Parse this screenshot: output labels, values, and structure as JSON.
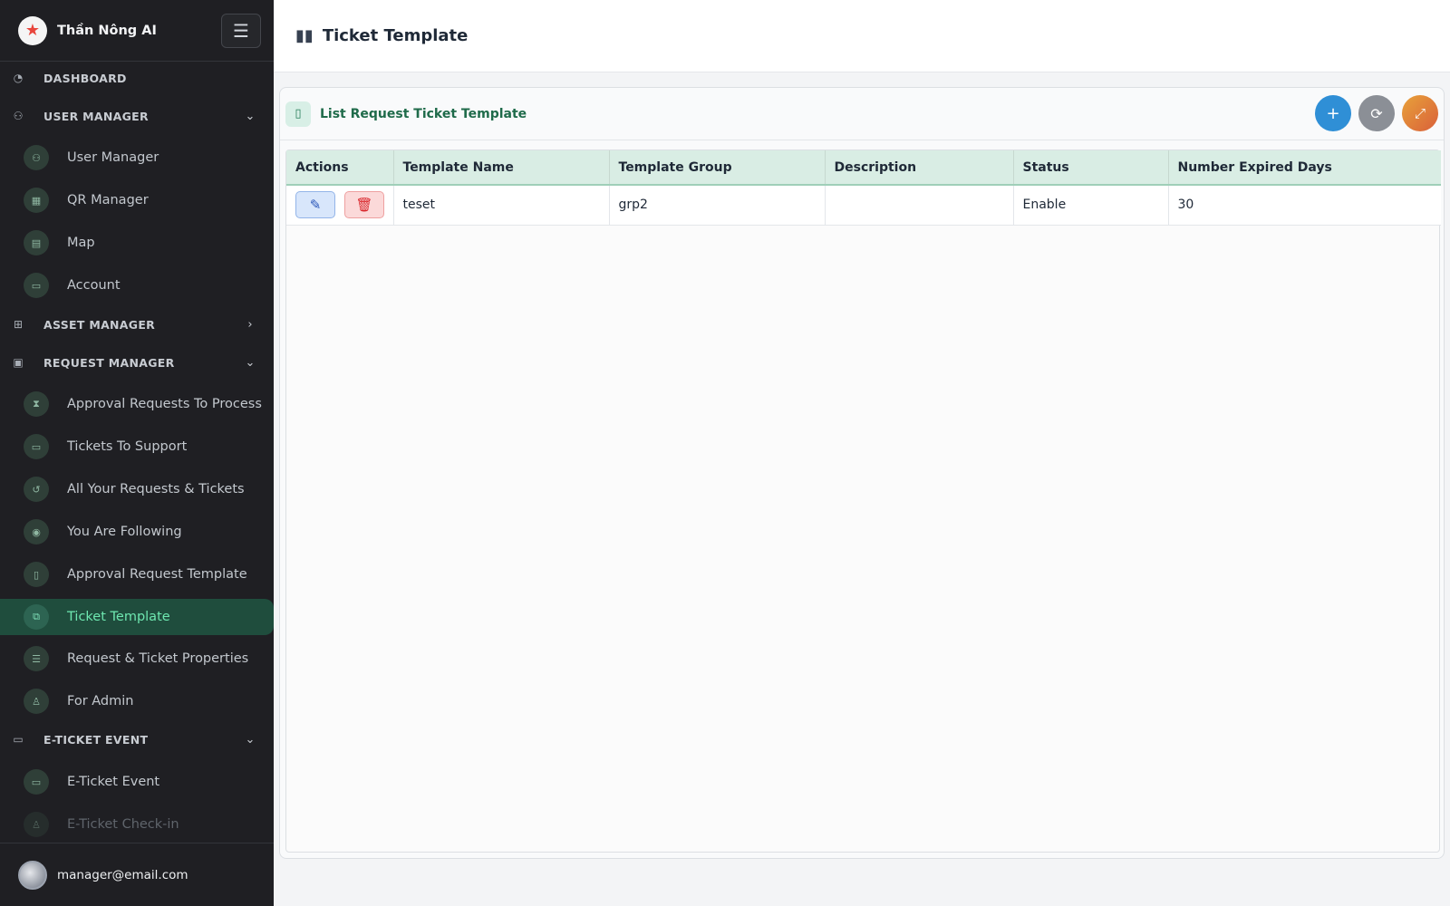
{
  "app": {
    "name": "Thần Nông AI",
    "logo_icon": "star-logo-icon"
  },
  "sidebar": {
    "sections": [
      {
        "label": "DASHBOARD",
        "icon": "dashboard-icon"
      },
      {
        "label": "USER MANAGER",
        "icon": "users-icon",
        "expanded": true
      },
      {
        "label": "ASSET MANAGER",
        "icon": "sitemap-icon",
        "expanded": false
      },
      {
        "label": "REQUEST MANAGER",
        "icon": "clipboard-icon",
        "expanded": true
      },
      {
        "label": "E-TICKET EVENT",
        "icon": "ticket-icon",
        "expanded": true
      }
    ],
    "items": [
      {
        "label": "User Manager",
        "icon": "user-group-icon"
      },
      {
        "label": "QR Manager",
        "icon": "qr-icon"
      },
      {
        "label": "Map",
        "icon": "map-icon"
      },
      {
        "label": "Account",
        "icon": "id-card-icon"
      },
      {
        "label": "Approval Requests To Process",
        "icon": "hourglass-icon"
      },
      {
        "label": "Tickets To Support",
        "icon": "ticket-icon"
      },
      {
        "label": "All Your Requests & Tickets",
        "icon": "history-icon"
      },
      {
        "label": "You Are Following",
        "icon": "eye-icon"
      },
      {
        "label": "Approval Request Template",
        "icon": "document-icon"
      },
      {
        "label": "Ticket Template",
        "icon": "copy-icon",
        "active": true
      },
      {
        "label": "Request & Ticket Properties",
        "icon": "sliders-icon"
      },
      {
        "label": "For Admin",
        "icon": "admin-icon"
      },
      {
        "label": "E-Ticket Event",
        "icon": "ticket-icon"
      },
      {
        "label": "E-Ticket Check-in",
        "icon": "checkin-icon"
      }
    ]
  },
  "user": {
    "email": "manager@email.com"
  },
  "header": {
    "title": "Ticket Template",
    "icon": "bar-chart-icon"
  },
  "panel": {
    "title": "List Request Ticket Template",
    "icon": "document-icon"
  },
  "table": {
    "columns": [
      "Actions",
      "Template Name",
      "Template Group",
      "Description",
      "Status",
      "Number Expired Days"
    ],
    "rows": [
      {
        "template_name": "teset",
        "template_group": "grp2",
        "description": "",
        "status": "Enable",
        "expired_days": "30"
      }
    ]
  },
  "colors": {
    "sidebar_bg": "#1f1f23",
    "active_item": "#1f4d3d",
    "accent_green": "#1f6b4a",
    "add_button": "#2f8fd6"
  }
}
